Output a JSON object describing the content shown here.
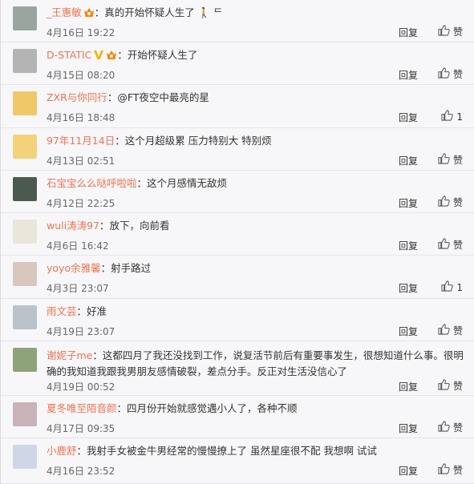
{
  "comments": [
    {
      "user": "_王惠敏",
      "text": "：真的开始怀疑人生了",
      "emoji": "🚶",
      "suffix": "ᄃ",
      "time": "4月16日 19:22",
      "reply": "回复",
      "like_label": "赞",
      "likes": "",
      "avatar_color": "#9aa5a0",
      "has_v": false,
      "has_vip": true
    },
    {
      "user": "D-STATIC",
      "text": "：开始怀疑人生了",
      "emoji": "",
      "suffix": "",
      "time": "4月15日 08:20",
      "reply": "回复",
      "like_label": "赞",
      "likes": "",
      "avatar_color": "#b4b4b4",
      "has_v": true,
      "has_vip": true
    },
    {
      "user": "ZXR与你同行",
      "text": "：@FT夜空中最亮的星",
      "emoji": "",
      "suffix": "",
      "time": "4月16日 18:48",
      "reply": "回复",
      "like_label": "",
      "likes": "1",
      "avatar_color": "#f0c86a",
      "has_v": false,
      "has_vip": false
    },
    {
      "user": "97年11月14日",
      "text": "：这个月超级累  压力特别大  特别烦",
      "emoji": "",
      "suffix": "",
      "time": "4月13日 02:51",
      "reply": "回复",
      "like_label": "赞",
      "likes": "",
      "avatar_color": "#f3d27a",
      "has_v": false,
      "has_vip": false
    },
    {
      "user": "石宝宝么么哒呼啦啦",
      "text": "：这个月感情无敌烦",
      "emoji": "",
      "suffix": "",
      "time": "4月12日 22:25",
      "reply": "回复",
      "like_label": "赞",
      "likes": "",
      "avatar_color": "#4a5a4e",
      "has_v": false,
      "has_vip": false
    },
    {
      "user": "wuli涛涛97",
      "text": "：放下，向前看",
      "emoji": "",
      "suffix": "",
      "time": "4月6日 16:42",
      "reply": "回复",
      "like_label": "赞",
      "likes": "",
      "avatar_color": "#e9e6da",
      "has_v": false,
      "has_vip": false
    },
    {
      "user": "yoyo余雅馨",
      "text": "：射手路过",
      "emoji": "",
      "suffix": "",
      "time": "4月3日 23:07",
      "reply": "回复",
      "like_label": "",
      "likes": "1",
      "avatar_color": "#d7c7bf",
      "has_v": false,
      "has_vip": false
    },
    {
      "user": "雨文芸",
      "text": "：好准",
      "emoji": "",
      "suffix": "",
      "time": "4月19日 23:07",
      "reply": "回复",
      "like_label": "赞",
      "likes": "",
      "avatar_color": "#b9c3c9",
      "has_v": false,
      "has_vip": false
    },
    {
      "user": "谢妮子me",
      "text": "：这都四月了我还没找到工作，说复活节前后有重要事发生，很想知道什么事。很明确的我知道我跟我男朋友感情破裂，差点分手。反正对生活没信心了",
      "emoji": "",
      "suffix": "",
      "time": "4月19日 00:52",
      "reply": "回复",
      "like_label": "赞",
      "likes": "",
      "avatar_color": "#8fa37a",
      "has_v": false,
      "has_vip": false
    },
    {
      "user": "夏冬唯至陌音颜",
      "text": "：四月份开始就感觉遇小人了，各种不顺",
      "emoji": "",
      "suffix": "",
      "time": "4月17日 09:35",
      "reply": "回复",
      "like_label": "赞",
      "likes": "",
      "avatar_color": "#c9b2b8",
      "has_v": false,
      "has_vip": false
    },
    {
      "user": "小鹿舒",
      "text": "：我射手女被金牛男经常的慢慢撩上了  虽然星座很不配  我想啊  试试",
      "emoji": "",
      "suffix": "",
      "time": "4月16日 23:52",
      "reply": "回复",
      "like_label": "赞",
      "likes": "",
      "avatar_color": "#cfd7e6",
      "has_v": false,
      "has_vip": false
    }
  ]
}
